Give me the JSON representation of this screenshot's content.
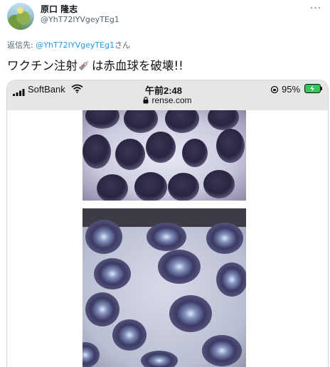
{
  "author": {
    "display_name": "原口 隆志",
    "handle": "@YhT72IYVgeyTEg1"
  },
  "reply": {
    "prefix": "返信先: ",
    "mention": "@YhT72IYVgeyTEg1",
    "suffix": "さん"
  },
  "tweet": {
    "text_before": "ワクチン注射",
    "emoji_icon": "syringe-icon",
    "text_after": "は赤血球を破壊!!"
  },
  "phone_status": {
    "carrier": "SoftBank",
    "time": "午前2:48",
    "battery_percent": "95%",
    "url": "rense.com"
  },
  "colors": {
    "link": "#1d9bf0",
    "secondary_text": "#536471",
    "battery_green": "#34c759"
  }
}
